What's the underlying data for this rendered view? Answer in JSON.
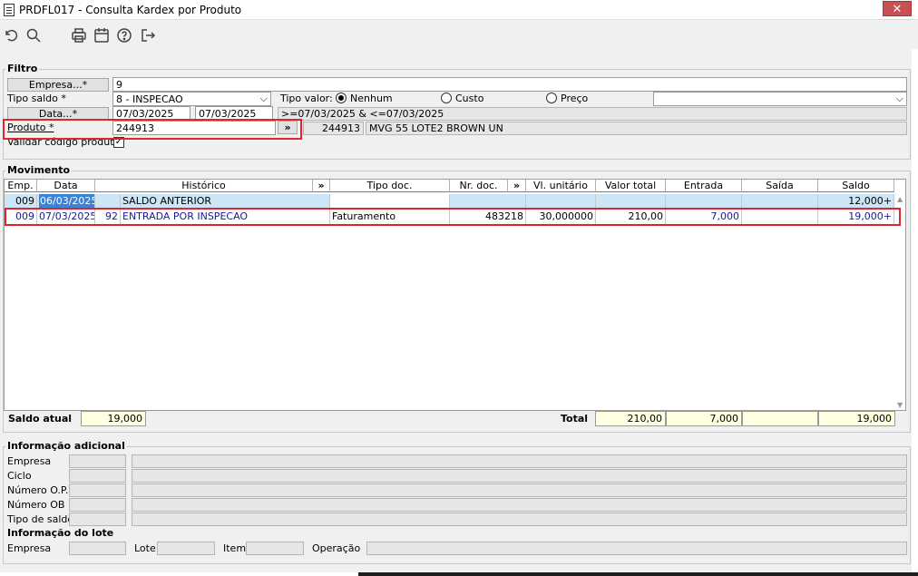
{
  "window": {
    "title": "PRDFL017 - Consulta Kardex por Produto",
    "close": "✕"
  },
  "toolbar": [
    "undo-icon",
    "search-icon",
    "print-icon",
    "calendar-icon",
    "help-icon",
    "exit-icon"
  ],
  "filtro": {
    "legend": "Filtro",
    "empresa_btn": "Empresa...*",
    "empresa_val": "9",
    "tipo_saldo_label": "Tipo saldo *",
    "tipo_saldo_val": "8 - INSPECAO",
    "tipo_valor_label": "Tipo valor:",
    "radio_nenhum": "Nenhum",
    "radio_custo": "Custo",
    "radio_preco": "Preço",
    "data_btn": "Data...*",
    "data_ini": "07/03/2025",
    "data_fim": "07/03/2025",
    "data_expr": ">=07/03/2025 & <=07/03/2025",
    "produto_label": "Produto *",
    "produto_val": "244913",
    "produto_btn": "»",
    "produto_code": "244913",
    "produto_desc": "MVG 55 LOTE2 BROWN UN",
    "validar_label": "Validar código produto"
  },
  "movimento": {
    "legend": "Movimento",
    "headers": [
      "Emp.",
      "Data",
      "Histórico",
      "»",
      "Tipo doc.",
      "Nr. doc.",
      "»",
      "Vl. unitário",
      "Valor total",
      "Entrada",
      "Saída",
      "Saldo"
    ],
    "rows": [
      {
        "emp": "009",
        "data": "06/03/2025",
        "num": "",
        "hist": "SALDO ANTERIOR",
        "tipo": "",
        "nr": "",
        "vlu": "",
        "vlt": "",
        "ent": "",
        "sai": "",
        "saldo": "12,000+"
      },
      {
        "emp": "009",
        "data": "07/03/2025",
        "num": "92",
        "hist": "ENTRADA POR INSPECAO",
        "tipo": "Faturamento",
        "nr": "483218",
        "vlu": "30,000000",
        "vlt": "210,00",
        "ent": "7,000",
        "sai": "",
        "saldo": "19,000+"
      }
    ],
    "saldo_atual_label": "Saldo atual",
    "saldo_atual": "19,000",
    "total_label": "Total",
    "total_valor": "210,00",
    "total_entrada": "7,000",
    "total_saldo": "19,000"
  },
  "info": {
    "legend": "Informação adicional",
    "labels": [
      "Empresa",
      "Ciclo",
      "Número O.P.",
      "Número OB",
      "Tipo de saldo"
    ]
  },
  "lote": {
    "legend": "Informação do lote",
    "empresa": "Empresa",
    "lote": "Lote",
    "item": "Item",
    "operacao": "Operação"
  }
}
